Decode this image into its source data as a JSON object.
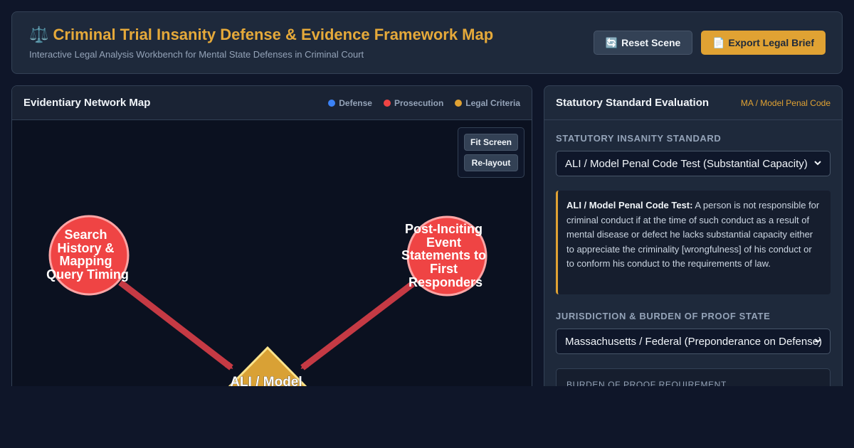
{
  "header": {
    "icon": "⚖️",
    "title": "Criminal Trial Insanity Defense & Evidence Framework Map",
    "subtitle": "Interactive Legal Analysis Workbench for Mental State Defenses in Criminal Court",
    "reset_icon": "🔄",
    "reset_label": "Reset Scene",
    "export_icon": "📄",
    "export_label": "Export Legal Brief"
  },
  "map": {
    "title": "Evidentiary Network Map",
    "legend": [
      {
        "label": "Defense",
        "color": "#3b82f6"
      },
      {
        "label": "Prosecution",
        "color": "#ef4444"
      },
      {
        "label": "Legal Criteria",
        "color": "#e0a233"
      }
    ],
    "controls": {
      "fit_label": "Fit Screen",
      "relayout_label": "Re-layout"
    },
    "nodes": [
      {
        "id": "search",
        "lines": [
          "Search",
          "History &",
          "Mapping",
          "Query Timing"
        ],
        "kind": "prosecution"
      },
      {
        "id": "post",
        "lines": [
          "Post-Inciting",
          "Event",
          "Statements to",
          "First",
          "Responders"
        ],
        "kind": "prosecution"
      },
      {
        "id": "ali",
        "lines": [
          "ALI / Model"
        ],
        "kind": "criteria"
      }
    ],
    "colors": {
      "prosecution": "#ef4444",
      "criteria": "#e0a233",
      "edge": "#c53a44"
    }
  },
  "evaluation": {
    "title": "Statutory Standard Evaluation",
    "jurisdiction_tag": "MA / Model Penal Code",
    "standard_label": "STATUTORY INSANITY STANDARD",
    "standard_selected": "ALI / Model Penal Code Test (Substantial Capacity)",
    "standard_term": "ALI / Model Penal Code Test:",
    "standard_text": "A person is not responsible for criminal conduct if at the time of such conduct as a result of mental disease or defect he lacks substantial capacity either to appreciate the criminality [wrongfulness] of his conduct or to conform his conduct to the requirements of law.",
    "jurisdiction_label": "JURISDICTION & BURDEN OF PROOF STATE",
    "jurisdiction_selected": "Massachusetts / Federal (Preponderance on Defense)",
    "burden_label": "BURDEN OF PROOF REQUIREMENT"
  }
}
